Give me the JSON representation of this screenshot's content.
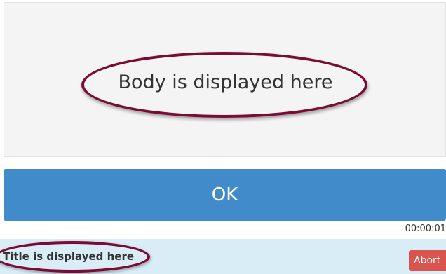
{
  "body": {
    "text": "Body is displayed here"
  },
  "ok_button": {
    "label": "OK"
  },
  "timer": {
    "value": "00:00:01"
  },
  "title_bar": {
    "title": "Title is displayed here",
    "abort_label": "Abort"
  },
  "colors": {
    "primary": "#428bca",
    "danger": "#d9534f",
    "info_background": "#d9edf7",
    "annotation": "#7a0b35"
  }
}
